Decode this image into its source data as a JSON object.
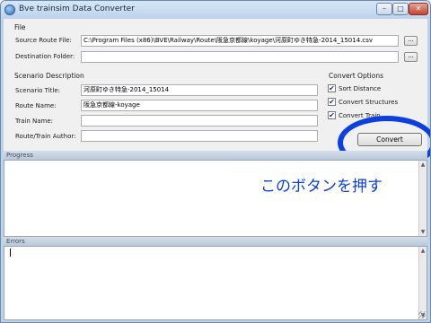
{
  "window": {
    "title": "Bve trainsim Data Converter"
  },
  "file": {
    "heading": "File",
    "source_label": "Source Route File:",
    "source_value": "C:\\Program Files (x86)\\BVE\\Railway\\Route\\阪急京都線\\koyage\\河原町ゆき特急-2014_15014.csv",
    "destination_label": "Destination Folder:",
    "destination_value": "",
    "browse_label": "..."
  },
  "scenario": {
    "heading": "Scenario Description",
    "title_label": "Scenario Title:",
    "title_value": "河原町ゆき特急-2014_15014",
    "route_label": "Route Name:",
    "route_value": "阪急京都線-koyage",
    "train_label": "Train Name:",
    "train_value": "",
    "author_label": "Route/Train Author:",
    "author_value": ""
  },
  "options": {
    "heading": "Convert Options",
    "items": [
      {
        "label": "Sort Distance",
        "checked": true
      },
      {
        "label": "Convert Structures",
        "checked": true
      },
      {
        "label": "Convert Train",
        "checked": true
      }
    ],
    "check_glyph": "✔",
    "convert_label": "Convert"
  },
  "progress": {
    "heading": "Progress",
    "annotation": "このボタンを押す"
  },
  "errors": {
    "heading": "Errors"
  },
  "colors": {
    "highlight": "#0a3fe0",
    "title_bar": "#bcd3ec"
  }
}
